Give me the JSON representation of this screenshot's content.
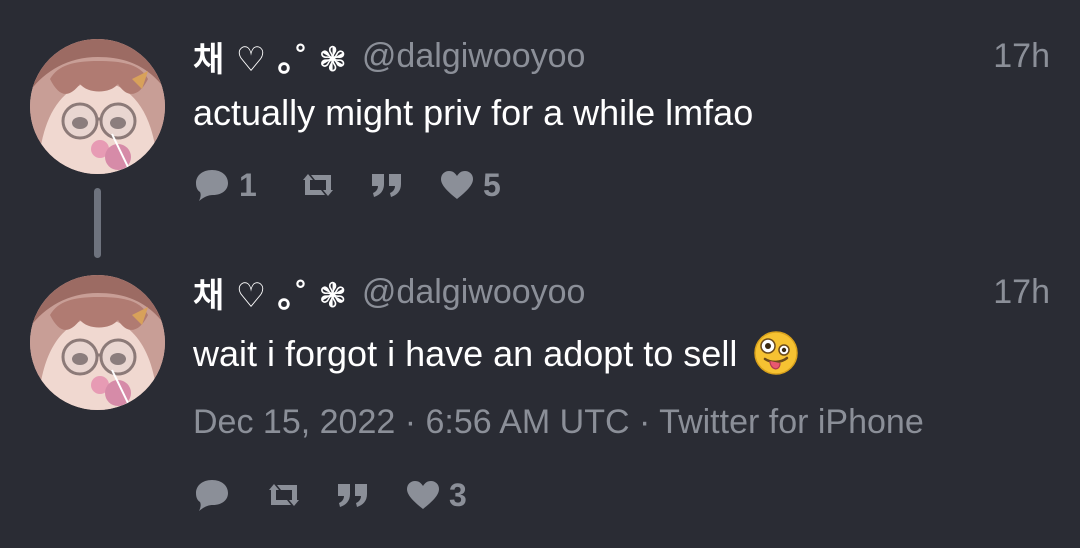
{
  "tweets": [
    {
      "display_name": "채 ♡ ｡˚ ❃",
      "handle": "@dalgiwooyoo",
      "time": "17h",
      "text": "actually might priv for a while lmfao",
      "replies": "1",
      "retweets": "",
      "quotes": "",
      "likes": "5"
    },
    {
      "display_name": "채 ♡ ｡˚ ❃",
      "handle": "@dalgiwooyoo",
      "time": "17h",
      "text": "wait i forgot i have an adopt to sell",
      "emoji": "zany-face",
      "date": "Dec 15, 2022",
      "separator": " · ",
      "clock": "6:56 AM UTC",
      "source": "Twitter for iPhone",
      "replies": "",
      "retweets": "",
      "quotes": "",
      "likes": "3"
    }
  ],
  "icons": {
    "reply": "speech-bubble-icon",
    "retweet": "retweet-icon",
    "quote": "quote-icon",
    "like": "heart-icon"
  },
  "colors": {
    "background": "#2a2c34",
    "text": "#ffffff",
    "muted": "#8b8f98",
    "thread_line": "#6e737e"
  }
}
